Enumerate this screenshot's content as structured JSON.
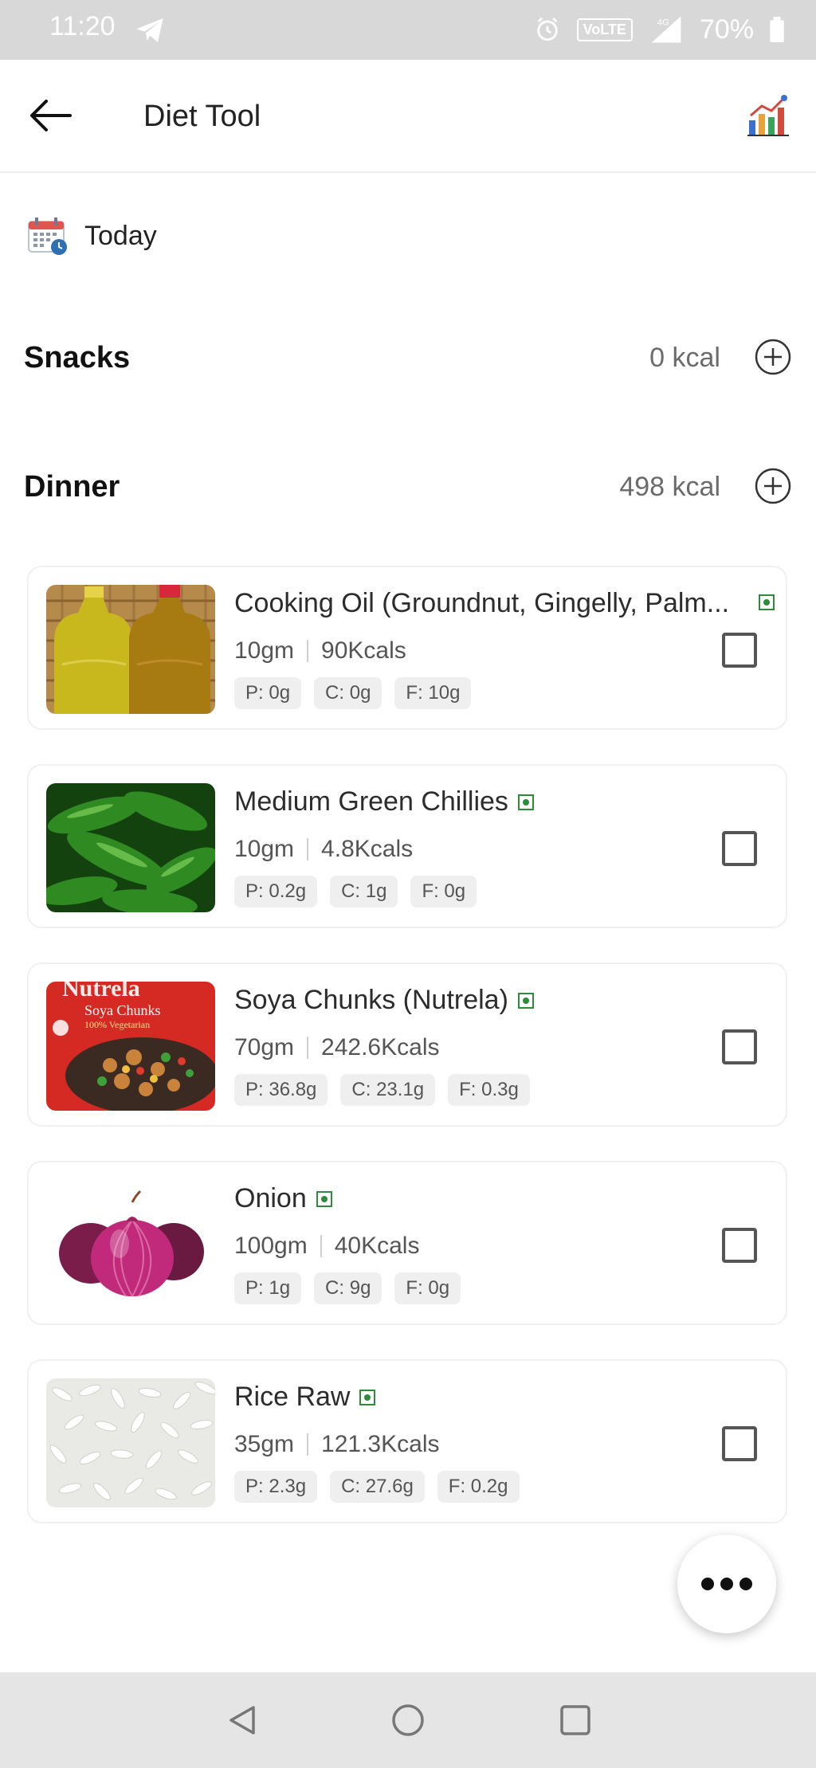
{
  "status_bar": {
    "time": "11:20",
    "volte": "VoLTE",
    "network": "4G",
    "battery": "70%"
  },
  "app_bar": {
    "title": "Diet Tool",
    "back_icon": "arrow-left-icon",
    "chart_icon": "bar-chart-icon"
  },
  "date": {
    "label": "Today",
    "icon": "calendar-icon"
  },
  "meals": [
    {
      "title": "Snacks",
      "kcal": "0 kcal"
    },
    {
      "title": "Dinner",
      "kcal": "498 kcal"
    }
  ],
  "foods": [
    {
      "name": "Cooking Oil (Groundnut, Gingelly, Palm...",
      "qty": "10gm",
      "kcal": "90Kcals",
      "p": "P: 0g",
      "c": "C: 0g",
      "f": "F: 10g",
      "image": "cooking-oil-bottles"
    },
    {
      "name": "Medium Green Chillies",
      "qty": "10gm",
      "kcal": "4.8Kcals",
      "p": "P: 0.2g",
      "c": "C: 1g",
      "f": "F: 0g",
      "image": "green-chillies"
    },
    {
      "name": "Soya Chunks (Nutrela)",
      "qty": "70gm",
      "kcal": "242.6Kcals",
      "p": "P: 36.8g",
      "c": "C: 23.1g",
      "f": "F: 0.3g",
      "image": "soya-chunks-pack",
      "pack_brand": "Nutrela",
      "pack_product": "Soya Chunks",
      "pack_tagline": "100% Vegetarian"
    },
    {
      "name": "Onion",
      "qty": "100gm",
      "kcal": "40Kcals",
      "p": "P: 1g",
      "c": "C: 9g",
      "f": "F: 0g",
      "image": "red-onions"
    },
    {
      "name": "Rice Raw",
      "qty": "35gm",
      "kcal": "121.3Kcals",
      "p": "P: 2.3g",
      "c": "C: 27.6g",
      "f": "F: 0.2g",
      "image": "raw-rice"
    }
  ],
  "colors": {
    "veg_green": "#2e8b3a",
    "status_bar": "#d8d8d8",
    "nav_bar": "#e5e5e5"
  }
}
